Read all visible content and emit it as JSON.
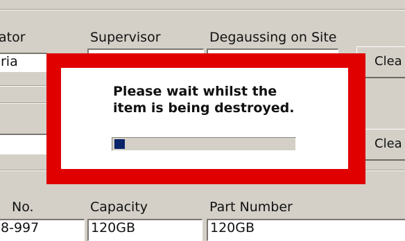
{
  "form": {
    "labels": {
      "operator": "ator",
      "supervisor": "Supervisor",
      "degaussing": "Degaussing on Site",
      "serial": "No.",
      "capacity": "Capacity",
      "part_number": "Part Number"
    },
    "values": {
      "operator": "ria",
      "serial": "8-997",
      "capacity": "120GB",
      "part_number": "120GB"
    },
    "buttons": {
      "clear_top": "Clea",
      "clear_bottom": "Clea"
    }
  },
  "dialog": {
    "message_line1": "Please wait whilst the",
    "message_line2": "item is being destroyed.",
    "progress_fraction": 0.06,
    "frame_color": "#e00000",
    "progress_color": "#0a246a"
  }
}
